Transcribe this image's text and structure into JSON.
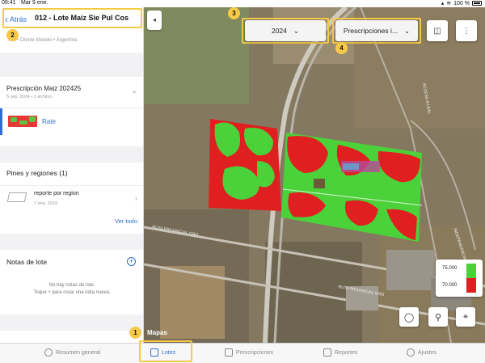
{
  "status_bar": {
    "time": "09:41",
    "date": "Mar 9 ene.",
    "battery": "100 %"
  },
  "header": {
    "back_label": "Atrás",
    "lot_title": "012 - Lote Maíz Sie Pul Cos",
    "breadcrumb": "...lia • Cliente Modelo • Argentina"
  },
  "prescription": {
    "title": "Prescripción Maiz 202425",
    "subtitle": "5 sep. 2024 • 1 archivo",
    "layer_label": "Rate"
  },
  "pins": {
    "section_title": "Pines y regiones (1)",
    "items": [
      {
        "name": "reporte por region",
        "date": "7 ene. 2019"
      }
    ],
    "see_all_label": "Ver todo"
  },
  "notes": {
    "section_title": "Notas de lote",
    "empty_line1": "No hay notas de lote.",
    "empty_line2": "Toque + para crear una nota nueva."
  },
  "map": {
    "year_select": "2024",
    "layer_select": "Prescripciones i...",
    "attribution": "Mapas",
    "road_labels": [
      "ACCESO A LEAL",
      "INDEPENDENCIA",
      "RUTA PROVINCIAL S262",
      "RUTA PROVINCIAL S263"
    ],
    "legend": [
      {
        "value": "75.000",
        "color": "#4bd13a"
      },
      {
        "value": "70.000",
        "color": "#e02020"
      }
    ]
  },
  "callouts": [
    "1",
    "2",
    "3",
    "4"
  ],
  "tabs": [
    {
      "label": "Resumen general",
      "active": false
    },
    {
      "label": "Lotes",
      "active": true
    },
    {
      "label": "Prescripciones",
      "active": false
    },
    {
      "label": "Reportes",
      "active": false
    },
    {
      "label": "Ajustes",
      "active": false
    }
  ],
  "colors": {
    "accent": "#2f6fd1",
    "highlight": "#f7c948",
    "rate_high": "#5cc644",
    "rate_low": "#e53935"
  }
}
